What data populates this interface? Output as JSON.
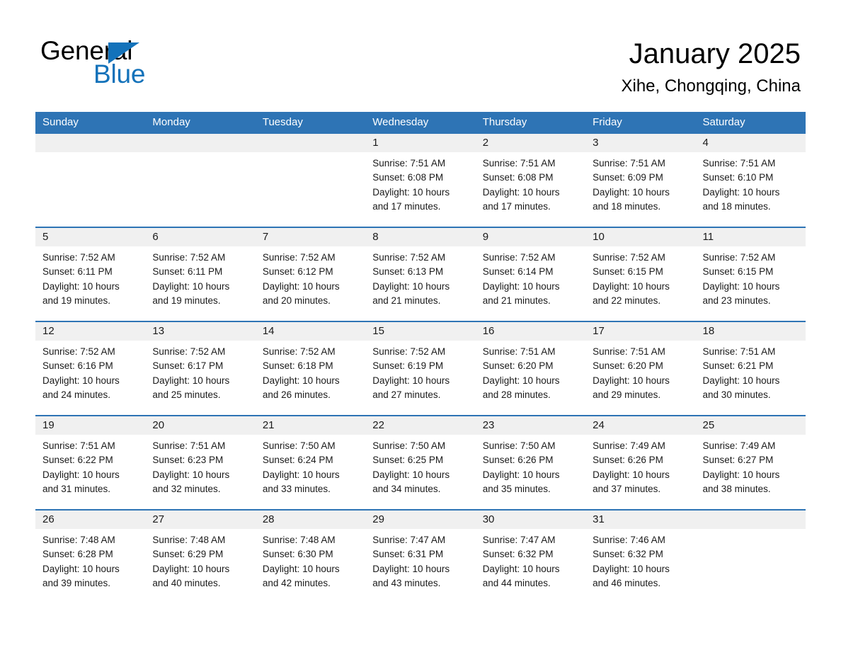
{
  "brand": {
    "name_part1": "General",
    "name_part2": "Blue",
    "accent_color": "#1372ba"
  },
  "header": {
    "title": "January 2025",
    "subtitle": "Xihe, Chongqing, China"
  },
  "calendar": {
    "header_bg_color": "#2e74b5",
    "weekdays": [
      "Sunday",
      "Monday",
      "Tuesday",
      "Wednesday",
      "Thursday",
      "Friday",
      "Saturday"
    ],
    "weeks": [
      [
        {
          "day": "",
          "sunrise": "",
          "sunset": "",
          "daylight1": "",
          "daylight2": ""
        },
        {
          "day": "",
          "sunrise": "",
          "sunset": "",
          "daylight1": "",
          "daylight2": ""
        },
        {
          "day": "",
          "sunrise": "",
          "sunset": "",
          "daylight1": "",
          "daylight2": ""
        },
        {
          "day": "1",
          "sunrise": "Sunrise: 7:51 AM",
          "sunset": "Sunset: 6:08 PM",
          "daylight1": "Daylight: 10 hours",
          "daylight2": "and 17 minutes."
        },
        {
          "day": "2",
          "sunrise": "Sunrise: 7:51 AM",
          "sunset": "Sunset: 6:08 PM",
          "daylight1": "Daylight: 10 hours",
          "daylight2": "and 17 minutes."
        },
        {
          "day": "3",
          "sunrise": "Sunrise: 7:51 AM",
          "sunset": "Sunset: 6:09 PM",
          "daylight1": "Daylight: 10 hours",
          "daylight2": "and 18 minutes."
        },
        {
          "day": "4",
          "sunrise": "Sunrise: 7:51 AM",
          "sunset": "Sunset: 6:10 PM",
          "daylight1": "Daylight: 10 hours",
          "daylight2": "and 18 minutes."
        }
      ],
      [
        {
          "day": "5",
          "sunrise": "Sunrise: 7:52 AM",
          "sunset": "Sunset: 6:11 PM",
          "daylight1": "Daylight: 10 hours",
          "daylight2": "and 19 minutes."
        },
        {
          "day": "6",
          "sunrise": "Sunrise: 7:52 AM",
          "sunset": "Sunset: 6:11 PM",
          "daylight1": "Daylight: 10 hours",
          "daylight2": "and 19 minutes."
        },
        {
          "day": "7",
          "sunrise": "Sunrise: 7:52 AM",
          "sunset": "Sunset: 6:12 PM",
          "daylight1": "Daylight: 10 hours",
          "daylight2": "and 20 minutes."
        },
        {
          "day": "8",
          "sunrise": "Sunrise: 7:52 AM",
          "sunset": "Sunset: 6:13 PM",
          "daylight1": "Daylight: 10 hours",
          "daylight2": "and 21 minutes."
        },
        {
          "day": "9",
          "sunrise": "Sunrise: 7:52 AM",
          "sunset": "Sunset: 6:14 PM",
          "daylight1": "Daylight: 10 hours",
          "daylight2": "and 21 minutes."
        },
        {
          "day": "10",
          "sunrise": "Sunrise: 7:52 AM",
          "sunset": "Sunset: 6:15 PM",
          "daylight1": "Daylight: 10 hours",
          "daylight2": "and 22 minutes."
        },
        {
          "day": "11",
          "sunrise": "Sunrise: 7:52 AM",
          "sunset": "Sunset: 6:15 PM",
          "daylight1": "Daylight: 10 hours",
          "daylight2": "and 23 minutes."
        }
      ],
      [
        {
          "day": "12",
          "sunrise": "Sunrise: 7:52 AM",
          "sunset": "Sunset: 6:16 PM",
          "daylight1": "Daylight: 10 hours",
          "daylight2": "and 24 minutes."
        },
        {
          "day": "13",
          "sunrise": "Sunrise: 7:52 AM",
          "sunset": "Sunset: 6:17 PM",
          "daylight1": "Daylight: 10 hours",
          "daylight2": "and 25 minutes."
        },
        {
          "day": "14",
          "sunrise": "Sunrise: 7:52 AM",
          "sunset": "Sunset: 6:18 PM",
          "daylight1": "Daylight: 10 hours",
          "daylight2": "and 26 minutes."
        },
        {
          "day": "15",
          "sunrise": "Sunrise: 7:52 AM",
          "sunset": "Sunset: 6:19 PM",
          "daylight1": "Daylight: 10 hours",
          "daylight2": "and 27 minutes."
        },
        {
          "day": "16",
          "sunrise": "Sunrise: 7:51 AM",
          "sunset": "Sunset: 6:20 PM",
          "daylight1": "Daylight: 10 hours",
          "daylight2": "and 28 minutes."
        },
        {
          "day": "17",
          "sunrise": "Sunrise: 7:51 AM",
          "sunset": "Sunset: 6:20 PM",
          "daylight1": "Daylight: 10 hours",
          "daylight2": "and 29 minutes."
        },
        {
          "day": "18",
          "sunrise": "Sunrise: 7:51 AM",
          "sunset": "Sunset: 6:21 PM",
          "daylight1": "Daylight: 10 hours",
          "daylight2": "and 30 minutes."
        }
      ],
      [
        {
          "day": "19",
          "sunrise": "Sunrise: 7:51 AM",
          "sunset": "Sunset: 6:22 PM",
          "daylight1": "Daylight: 10 hours",
          "daylight2": "and 31 minutes."
        },
        {
          "day": "20",
          "sunrise": "Sunrise: 7:51 AM",
          "sunset": "Sunset: 6:23 PM",
          "daylight1": "Daylight: 10 hours",
          "daylight2": "and 32 minutes."
        },
        {
          "day": "21",
          "sunrise": "Sunrise: 7:50 AM",
          "sunset": "Sunset: 6:24 PM",
          "daylight1": "Daylight: 10 hours",
          "daylight2": "and 33 minutes."
        },
        {
          "day": "22",
          "sunrise": "Sunrise: 7:50 AM",
          "sunset": "Sunset: 6:25 PM",
          "daylight1": "Daylight: 10 hours",
          "daylight2": "and 34 minutes."
        },
        {
          "day": "23",
          "sunrise": "Sunrise: 7:50 AM",
          "sunset": "Sunset: 6:26 PM",
          "daylight1": "Daylight: 10 hours",
          "daylight2": "and 35 minutes."
        },
        {
          "day": "24",
          "sunrise": "Sunrise: 7:49 AM",
          "sunset": "Sunset: 6:26 PM",
          "daylight1": "Daylight: 10 hours",
          "daylight2": "and 37 minutes."
        },
        {
          "day": "25",
          "sunrise": "Sunrise: 7:49 AM",
          "sunset": "Sunset: 6:27 PM",
          "daylight1": "Daylight: 10 hours",
          "daylight2": "and 38 minutes."
        }
      ],
      [
        {
          "day": "26",
          "sunrise": "Sunrise: 7:48 AM",
          "sunset": "Sunset: 6:28 PM",
          "daylight1": "Daylight: 10 hours",
          "daylight2": "and 39 minutes."
        },
        {
          "day": "27",
          "sunrise": "Sunrise: 7:48 AM",
          "sunset": "Sunset: 6:29 PM",
          "daylight1": "Daylight: 10 hours",
          "daylight2": "and 40 minutes."
        },
        {
          "day": "28",
          "sunrise": "Sunrise: 7:48 AM",
          "sunset": "Sunset: 6:30 PM",
          "daylight1": "Daylight: 10 hours",
          "daylight2": "and 42 minutes."
        },
        {
          "day": "29",
          "sunrise": "Sunrise: 7:47 AM",
          "sunset": "Sunset: 6:31 PM",
          "daylight1": "Daylight: 10 hours",
          "daylight2": "and 43 minutes."
        },
        {
          "day": "30",
          "sunrise": "Sunrise: 7:47 AM",
          "sunset": "Sunset: 6:32 PM",
          "daylight1": "Daylight: 10 hours",
          "daylight2": "and 44 minutes."
        },
        {
          "day": "31",
          "sunrise": "Sunrise: 7:46 AM",
          "sunset": "Sunset: 6:32 PM",
          "daylight1": "Daylight: 10 hours",
          "daylight2": "and 46 minutes."
        },
        {
          "day": "",
          "sunrise": "",
          "sunset": "",
          "daylight1": "",
          "daylight2": ""
        }
      ]
    ]
  }
}
